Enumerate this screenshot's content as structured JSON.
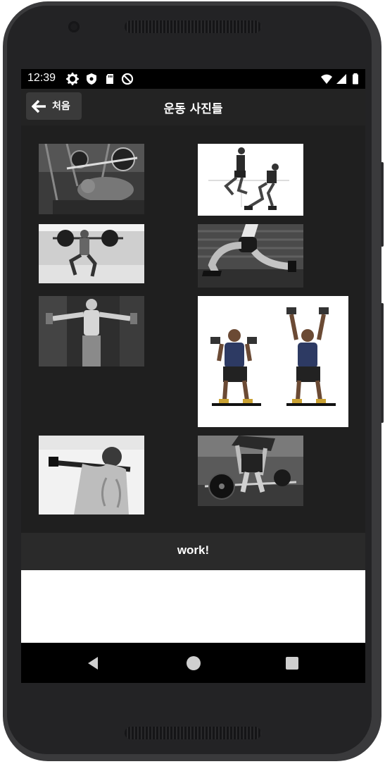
{
  "status_bar": {
    "time": "12:39",
    "left_icons": [
      "gear-icon",
      "shield-icon",
      "sd-card-icon",
      "no-disturb-icon"
    ],
    "right_icons": [
      "wifi-icon",
      "cell-signal-icon",
      "battery-icon"
    ]
  },
  "app_bar": {
    "back_label": "처음",
    "title": "운동 사진들"
  },
  "photos": [
    {
      "name": "bench-press-photo"
    },
    {
      "name": "jump-squat-photo"
    },
    {
      "name": "barbell-squat-photo"
    },
    {
      "name": "lunge-photo"
    },
    {
      "name": "lateral-raise-photo"
    },
    {
      "name": "dumbbell-shoulder-press-photo"
    },
    {
      "name": "pull-up-photo"
    },
    {
      "name": "deadlift-photo"
    }
  ],
  "bottom_label": "work!",
  "nav_bar": {
    "icons": [
      "back-icon",
      "home-icon",
      "recents-icon"
    ]
  },
  "colors": {
    "screen_bg": "#232323",
    "grid_bg": "#1f1f1f",
    "back_button_bg": "#3a3a3a",
    "status_bar_bg": "#000000"
  }
}
